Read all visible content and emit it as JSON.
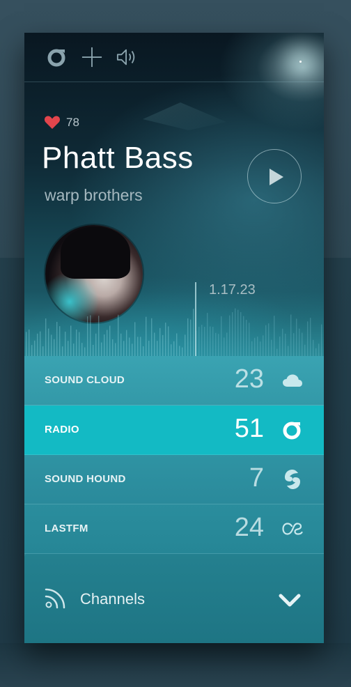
{
  "player": {
    "likes": "78",
    "title": "Phatt Bass",
    "artist": "warp brothers",
    "duration": "1.17.23"
  },
  "toolbar": {
    "icons": [
      "radio-icon",
      "plus-icon",
      "volume-icon"
    ]
  },
  "sources": [
    {
      "label": "SOUND CLOUD",
      "count": "23",
      "icon": "cloud-icon"
    },
    {
      "label": "RADIO",
      "count": "51",
      "icon": "radio-icon",
      "active": true
    },
    {
      "label": "SOUND HOUND",
      "count": "7",
      "icon": "soundhound-icon"
    },
    {
      "label": "LASTFM",
      "count": "24",
      "icon": "lastfm-icon"
    }
  ],
  "channels": {
    "label": "Channels"
  },
  "colors": {
    "accent": "#13bac4",
    "heart": "#e2454c"
  }
}
